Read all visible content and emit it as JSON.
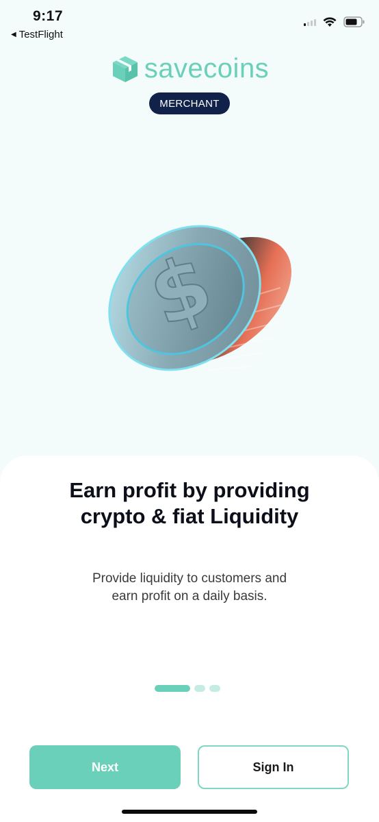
{
  "status_bar": {
    "time": "9:17",
    "back_app": "TestFlight",
    "icons": [
      "signal-icon",
      "wifi-icon",
      "battery-icon"
    ]
  },
  "brand": {
    "logo_text": "savecoins",
    "badge": "MERCHANT",
    "accent": "#6bd0b9",
    "badge_color": "#10224a"
  },
  "onboarding": {
    "headline_line1": "Earn profit by providing",
    "headline_line2": "crypto & fiat Liquidity",
    "subtext_line1": "Provide liquidity to customers and",
    "subtext_line2": "earn profit on a daily basis.",
    "page_count": 3,
    "current_page": 1
  },
  "actions": {
    "next_label": "Next",
    "signin_label": "Sign In"
  }
}
